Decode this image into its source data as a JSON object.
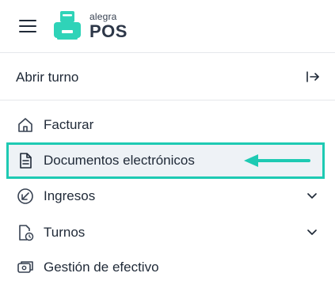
{
  "header": {
    "menu_icon": "hamburger-menu-icon",
    "logo_small": "alegra",
    "logo_big": "POS",
    "brand_color": "#2fd3b8"
  },
  "shift": {
    "label": "Abrir turno",
    "icon": "collapse-sidebar-icon"
  },
  "menu": {
    "items": [
      {
        "label": "Facturar",
        "icon": "home-icon"
      },
      {
        "label": "Documentos electrónicos",
        "icon": "document-icon",
        "highlighted": true
      },
      {
        "label": "Ingresos",
        "icon": "arrow-down-left-circle-icon",
        "expandable": true
      },
      {
        "label": "Turnos",
        "icon": "file-clock-icon",
        "expandable": true
      },
      {
        "label": "Gestión de efectivo",
        "icon": "cash-register-icon"
      }
    ]
  },
  "annotation": {
    "highlight_color": "#1ecab3",
    "arrow_icon": "left-arrow-annotation-icon"
  }
}
